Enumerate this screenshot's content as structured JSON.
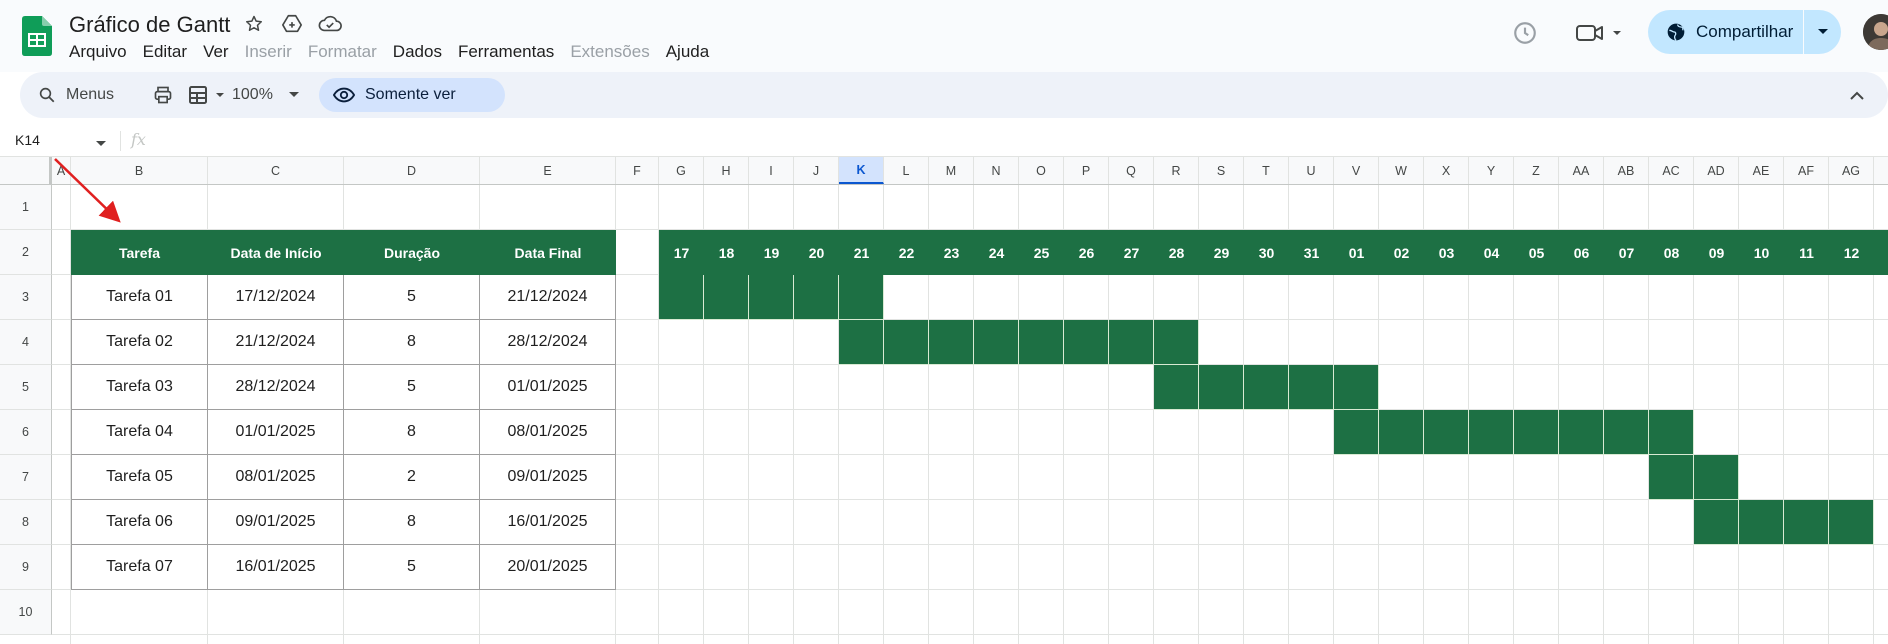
{
  "doc": {
    "title": "Gráfico de Gantt"
  },
  "menu": [
    "Arquivo",
    "Editar",
    "Ver",
    "Inserir",
    "Formatar",
    "Dados",
    "Ferramentas",
    "Extensões",
    "Ajuda"
  ],
  "menu_disabled": [
    "Inserir",
    "Formatar",
    "Extensões"
  ],
  "share": {
    "label": "Compartilhar"
  },
  "toolbar": {
    "search_label": "Menus",
    "zoom": "100%",
    "view_only_label": "Somente ver"
  },
  "formula_bar": {
    "cell_ref": "K14",
    "fx": "fx"
  },
  "columns": [
    "A",
    "B",
    "C",
    "D",
    "E",
    "F",
    "G",
    "H",
    "I",
    "J",
    "K",
    "L",
    "M",
    "N",
    "O",
    "P",
    "Q",
    "R",
    "S",
    "T",
    "U",
    "V",
    "W",
    "X",
    "Y",
    "Z",
    "AA",
    "AB",
    "AC",
    "AD",
    "AE",
    "AF",
    "AG"
  ],
  "selected_column": "K",
  "rows": [
    "1",
    "2",
    "3",
    "4",
    "5",
    "6",
    "7",
    "8",
    "9",
    "10"
  ],
  "table": {
    "headers": [
      "Tarefa",
      "Data de Início",
      "Duração",
      "Data Final"
    ],
    "rows": [
      [
        "Tarefa 01",
        "17/12/2024",
        "5",
        "21/12/2024"
      ],
      [
        "Tarefa 02",
        "21/12/2024",
        "8",
        "28/12/2024"
      ],
      [
        "Tarefa 03",
        "28/12/2024",
        "5",
        "01/01/2025"
      ],
      [
        "Tarefa 04",
        "01/01/2025",
        "8",
        "08/01/2025"
      ],
      [
        "Tarefa 05",
        "08/01/2025",
        "2",
        "09/01/2025"
      ],
      [
        "Tarefa 06",
        "09/01/2025",
        "8",
        "16/01/2025"
      ],
      [
        "Tarefa 07",
        "16/01/2025",
        "5",
        "20/01/2025"
      ]
    ]
  },
  "gantt": {
    "days": [
      "17",
      "18",
      "19",
      "20",
      "21",
      "22",
      "23",
      "24",
      "25",
      "26",
      "27",
      "28",
      "29",
      "30",
      "31",
      "01",
      "02",
      "03",
      "04",
      "05",
      "06",
      "07",
      "08",
      "09",
      "10",
      "11",
      "12"
    ],
    "bars": [
      {
        "start": "17",
        "end": "21"
      },
      {
        "start": "21",
        "end": "28"
      },
      {
        "start": "28",
        "end": "01"
      },
      {
        "start": "01",
        "end": "08"
      },
      {
        "start": "08",
        "end": "09"
      },
      {
        "start": "09",
        "end": "12"
      },
      {
        "start": null,
        "end": null
      }
    ],
    "fill_color": "#1d7044"
  },
  "icons": {
    "star": "star-icon",
    "move": "move-to-drive-icon",
    "cloud": "cloud-status-icon",
    "history": "history-icon",
    "meet": "video-call-icon",
    "globe": "globe-icon",
    "search": "search-icon",
    "print": "print-icon",
    "format": "paint-format-icon",
    "eye": "eye-icon",
    "collapse": "chevron-up-icon"
  },
  "accent_color": "#1d7044",
  "annotation_color": "#e02020"
}
